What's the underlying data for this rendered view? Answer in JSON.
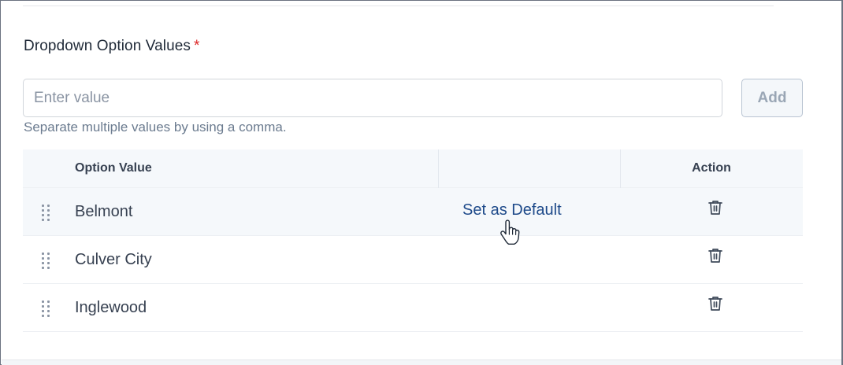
{
  "section": {
    "label": "Dropdown Option Values",
    "required_marker": "*"
  },
  "input": {
    "placeholder": "Enter value",
    "value": "",
    "add_label": "Add",
    "helper": "Separate multiple values by using a comma."
  },
  "table": {
    "headers": {
      "option_value": "Option Value",
      "middle": "",
      "action": "Action"
    },
    "rows": [
      {
        "label": "Belmont",
        "set_default_label": "Set as Default",
        "hovered": true
      },
      {
        "label": "Culver City",
        "set_default_label": "",
        "hovered": false
      },
      {
        "label": "Inglewood",
        "set_default_label": "",
        "hovered": false
      }
    ]
  },
  "icons": {
    "drag": "drag-handle-icon",
    "delete": "trash-icon",
    "cursor": "hand-pointer-icon"
  },
  "colors": {
    "required": "#dc2626",
    "link": "#1e4a8a",
    "header_bg": "#f5f8fb",
    "muted_text": "#6b7b8f"
  }
}
